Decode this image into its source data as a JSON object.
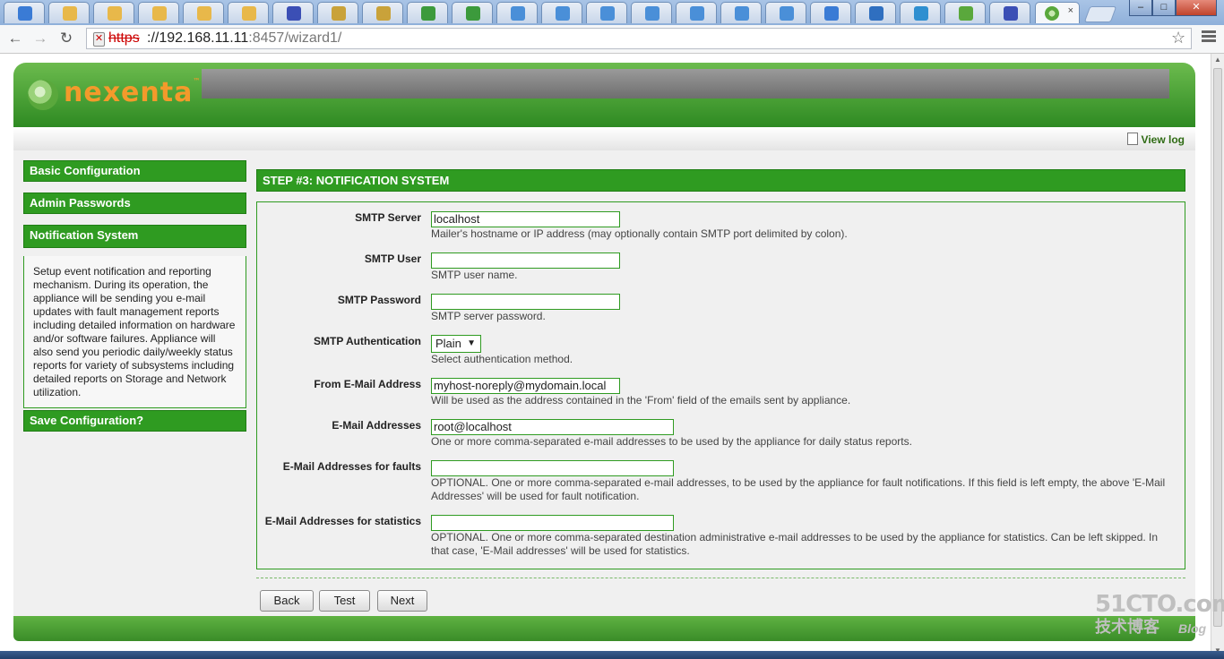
{
  "browser": {
    "tabs": [
      {
        "icon": "folder-icon",
        "color": "#3a7bd5"
      },
      {
        "icon": "chat-icon",
        "color": "#e8b84a"
      },
      {
        "icon": "chat-icon",
        "color": "#e8b84a"
      },
      {
        "icon": "chat-icon",
        "color": "#e8b84a"
      },
      {
        "icon": "chat-icon",
        "color": "#e8b84a"
      },
      {
        "icon": "chat-icon",
        "color": "#e8b84a"
      },
      {
        "icon": "paw-icon",
        "color": "#3b4fb5"
      },
      {
        "icon": "notepad-icon",
        "color": "#c9a23a"
      },
      {
        "icon": "notepad-icon",
        "color": "#c9a23a"
      },
      {
        "icon": "mx-icon",
        "color": "#3c9a3c"
      },
      {
        "icon": "mx-icon",
        "color": "#3c9a3c"
      },
      {
        "icon": "play-icon",
        "color": "#4a8fd8"
      },
      {
        "icon": "play-icon",
        "color": "#4a8fd8"
      },
      {
        "icon": "play-icon",
        "color": "#4a8fd8"
      },
      {
        "icon": "play-icon",
        "color": "#4a8fd8"
      },
      {
        "icon": "play-icon",
        "color": "#4a8fd8"
      },
      {
        "icon": "play-icon",
        "color": "#4a8fd8"
      },
      {
        "icon": "play-icon",
        "color": "#4a8fd8"
      },
      {
        "icon": "folder-icon",
        "color": "#3a7bd5"
      },
      {
        "icon": "home-icon",
        "color": "#2f6fc0"
      },
      {
        "icon": "refresh-icon",
        "color": "#2f8fd0"
      },
      {
        "icon": "nexenta-icon",
        "color": "#5aa83c"
      },
      {
        "icon": "paw-icon",
        "color": "#3b4fb5"
      }
    ],
    "active_tab": {
      "icon": "nexenta-icon",
      "close": "×"
    },
    "url_scheme": "https",
    "url_host": "://192.168.11.11",
    "url_port": ":8457",
    "url_path": "/wizard1/"
  },
  "header": {
    "logo": "nexenta",
    "logo_tm": "™",
    "view_log": "View log"
  },
  "sidebar": {
    "items": [
      {
        "label": "Basic Configuration"
      },
      {
        "label": "Admin Passwords"
      },
      {
        "label": "Notification System"
      },
      {
        "label": "Save Configuration?"
      }
    ],
    "description": "Setup event notification and reporting mechanism. During its operation, the appliance will be sending you e-mail updates with fault management reports including detailed information on hardware and/or software failures. Appliance will also send you periodic daily/weekly status reports for variety of subsystems including detailed reports on Storage and Network utilization."
  },
  "main": {
    "step_title": "STEP #3: NOTIFICATION SYSTEM",
    "fields": {
      "smtp_server": {
        "label": "SMTP Server",
        "value": "localhost",
        "hint": "Mailer's hostname or IP address (may optionally contain SMTP port delimited by colon)."
      },
      "smtp_user": {
        "label": "SMTP User",
        "value": "",
        "hint": "SMTP user name."
      },
      "smtp_password": {
        "label": "SMTP Password",
        "value": "",
        "hint": "SMTP server password."
      },
      "smtp_auth": {
        "label": "SMTP Authentication",
        "value": "Plain",
        "hint": "Select authentication method."
      },
      "from_email": {
        "label": "From E-Mail Address",
        "value": "myhost-noreply@mydomain.local",
        "hint": "Will be used as the address contained in the 'From' field of the emails sent by appliance."
      },
      "email_addresses": {
        "label": "E-Mail Addresses",
        "value": "root@localhost",
        "hint": "One or more comma-separated e-mail addresses to be used by the appliance for daily status reports."
      },
      "email_faults": {
        "label": "E-Mail Addresses for faults",
        "value": "",
        "hint": "OPTIONAL. One or more comma-separated e-mail addresses, to be used by the appliance for fault notifications. If this field is left empty, the above 'E-Mail Addresses' will be used for fault notification."
      },
      "email_stats": {
        "label": "E-Mail Addresses for statistics",
        "value": "",
        "hint": "OPTIONAL. One or more comma-separated destination administrative e-mail addresses to be used by the appliance for statistics. Can be left skipped. In that case, 'E-Mail addresses' will be used for statistics."
      }
    },
    "buttons": {
      "back": "Back",
      "test": "Test",
      "next": "Next"
    }
  },
  "watermark": {
    "line1": "51CTO.com",
    "line2": "技术博客",
    "line3": "Blog"
  }
}
